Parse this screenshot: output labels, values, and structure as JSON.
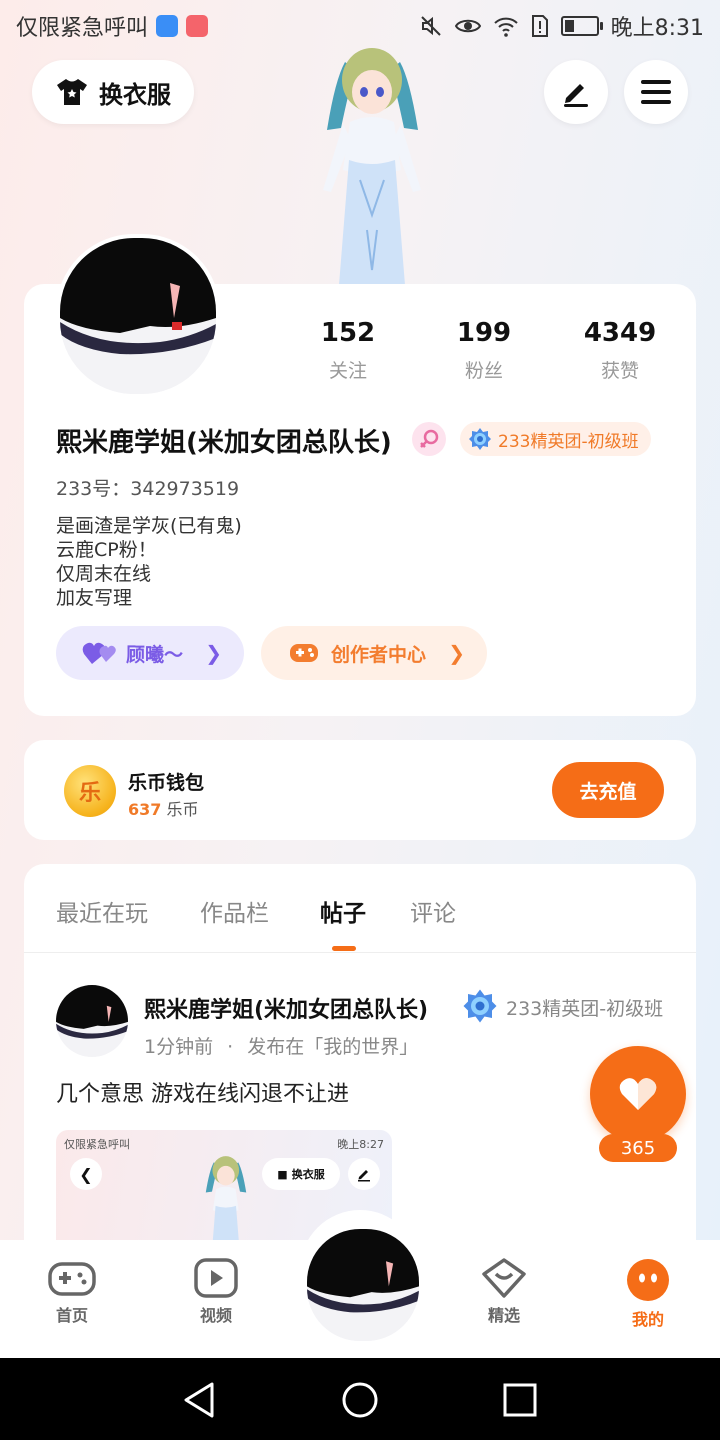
{
  "status_bar": {
    "left_text": "仅限紧急呼叫",
    "time": "晚上8:31",
    "battery_level": 0.3
  },
  "header": {
    "outfit_label": "换衣服",
    "edit_icon": "pen-icon",
    "menu_icon": "hamburger-menu-icon"
  },
  "profile": {
    "stats": [
      {
        "value": "152",
        "label": "关注"
      },
      {
        "value": "199",
        "label": "粉丝"
      },
      {
        "value": "4349",
        "label": "获赞"
      }
    ],
    "name": "熙米鹿学姐(米加女团总队长)",
    "rank_badge": "233精英团-初级班",
    "uid": "233号：342973519",
    "bio": [
      "是画渣是学灰(已有鬼)",
      "云鹿CP粉！",
      "仅周末在线",
      "加友写理"
    ],
    "pill_friend": "顾曦～",
    "pill_creator": "创作者中心"
  },
  "wallet": {
    "title": "乐币钱包",
    "balance": "637",
    "unit": "乐币",
    "coin_char": "乐",
    "recharge_label": "去充值"
  },
  "tabs": [
    {
      "label": "最近在玩",
      "active": false
    },
    {
      "label": "作品栏",
      "active": false
    },
    {
      "label": "帖子",
      "active": true
    },
    {
      "label": "评论",
      "active": false
    }
  ],
  "post": {
    "author": "熙米鹿学姐(米加女团总队长)",
    "rank": "233精英团-初级班",
    "time": "1分钟前",
    "separator": "·",
    "location": "发布在「我的世界」",
    "text": "几个意思 游戏在线闪退不让进",
    "thumb": {
      "status_left": "仅限紧急呼叫",
      "status_time": "晚上8:27",
      "outfit_label": "换衣服"
    }
  },
  "like": {
    "count": "365"
  },
  "bottom_nav": [
    {
      "label": "首页",
      "icon": "gamepad-icon",
      "active": false
    },
    {
      "label": "视频",
      "icon": "video-icon",
      "active": false
    },
    {
      "label": "精选",
      "icon": "heart-box-icon",
      "active": false
    },
    {
      "label": "我的",
      "icon": "face-icon",
      "active": true
    }
  ],
  "colors": {
    "accent": "#f56d17",
    "purple": "#7b5ce6"
  }
}
